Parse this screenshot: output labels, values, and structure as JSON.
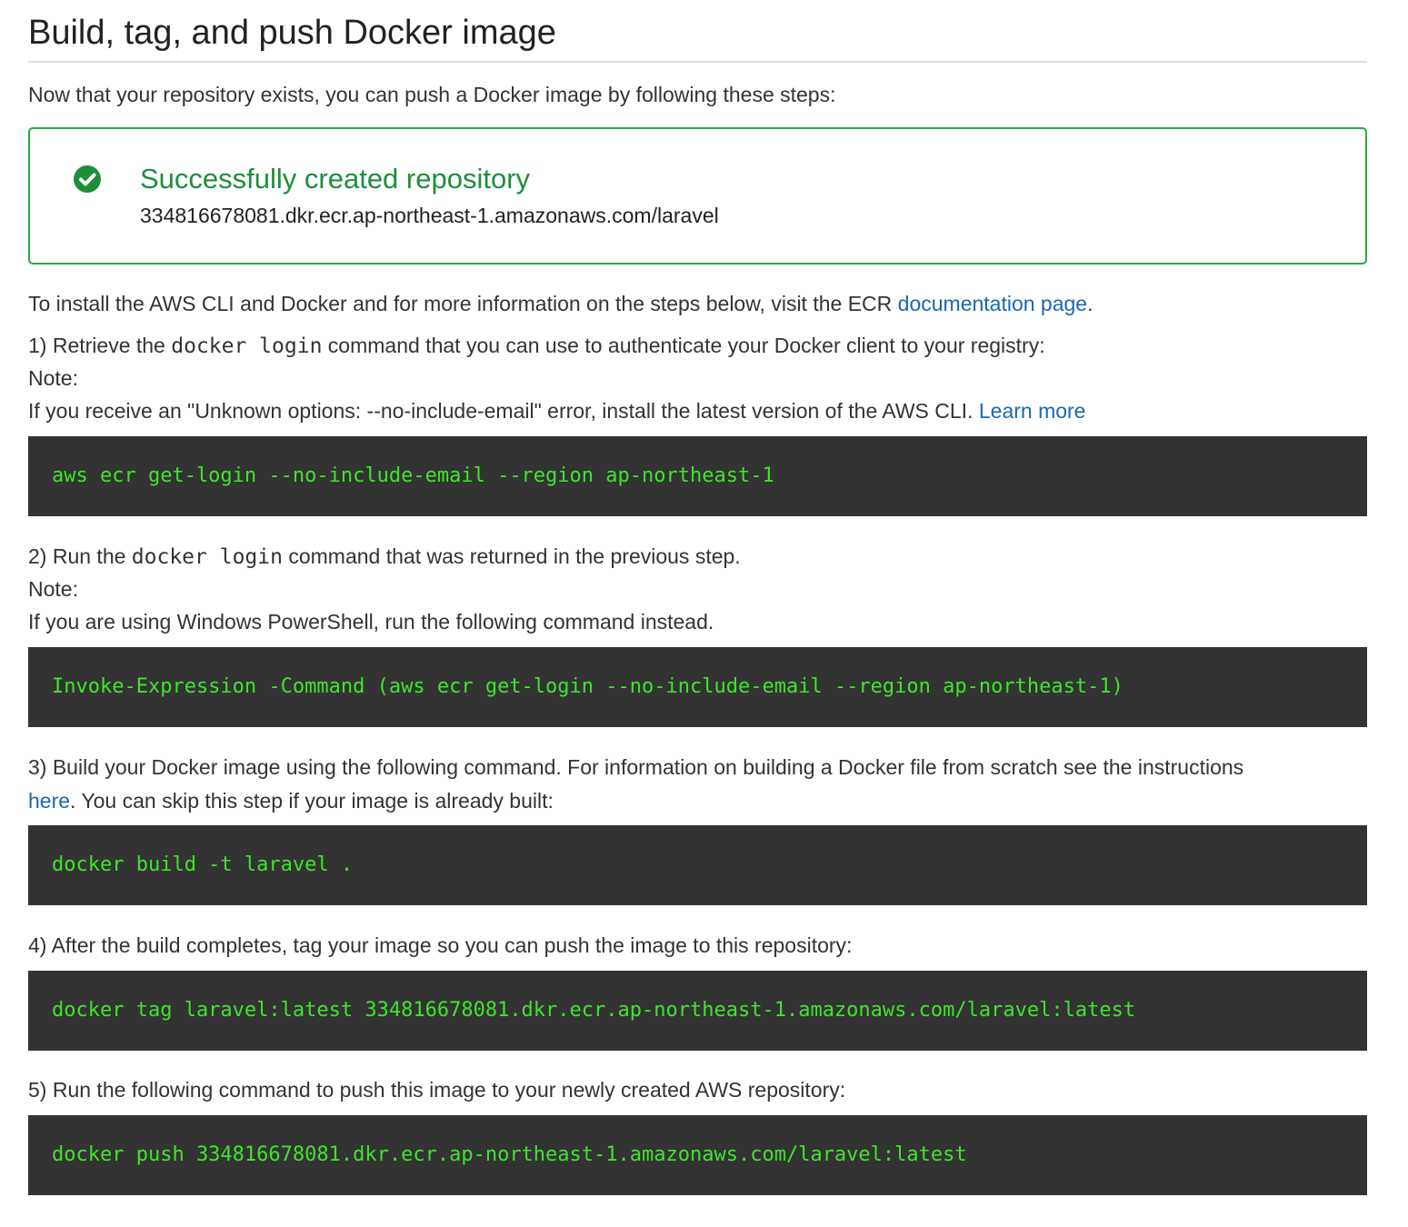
{
  "header": {
    "title": "Build, tag, and push Docker image"
  },
  "intro": "Now that your repository exists, you can push a Docker image by following these steps:",
  "success": {
    "icon": "check-circle-icon",
    "color": "#2aa845",
    "title": "Successfully created repository",
    "repository_uri": "334816678081.dkr.ecr.ap-northeast-1.amazonaws.com/laravel"
  },
  "install_info": {
    "text": "To install the AWS CLI and Docker and for more information on the steps below, visit the ECR ",
    "link_label": "documentation page",
    "suffix": "."
  },
  "steps": [
    {
      "prefix": "1) Retrieve the ",
      "code": "docker login",
      "suffix": " command that you can use to authenticate your Docker client to your registry:",
      "note_label": "Note:",
      "note_text": "If you receive an \"Unknown options: --no-include-email\" error, install the latest version of the AWS CLI. ",
      "note_link": "Learn more",
      "command": "aws ecr get-login --no-include-email --region ap-northeast-1"
    },
    {
      "prefix": "2) Run the ",
      "code": "docker login",
      "suffix": " command that was returned in the previous step.",
      "note_label": "Note:",
      "note_text": "If you are using Windows PowerShell, run the following command instead.",
      "command": "Invoke-Expression -Command (aws ecr get-login --no-include-email --region ap-northeast-1)"
    },
    {
      "line1": "3) Build your Docker image using the following command. For information on building a Docker file from scratch see the instructions",
      "link": "here",
      "line2": ". You can skip this step if your image is already built:",
      "command": "docker build -t laravel ."
    },
    {
      "text": "4) After the build completes, tag your image so you can push the image to this repository:",
      "command": "docker tag laravel:latest 334816678081.dkr.ecr.ap-northeast-1.amazonaws.com/laravel:latest"
    },
    {
      "text": "5) Run the following command to push this image to your newly created AWS repository:",
      "command": "docker push 334816678081.dkr.ecr.ap-northeast-1.amazonaws.com/laravel:latest"
    }
  ],
  "theme": {
    "link_color": "#1a66b3",
    "code_background": "#333333",
    "code_text_color": "#3fe52b"
  }
}
